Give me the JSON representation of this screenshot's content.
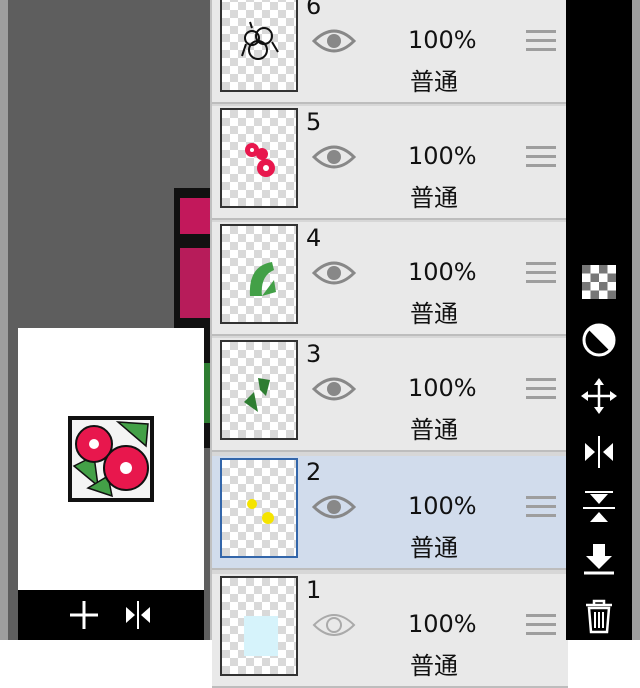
{
  "layers": [
    {
      "number": "6",
      "opacity": "100%",
      "blend": "普通",
      "visible": true
    },
    {
      "number": "5",
      "opacity": "100%",
      "blend": "普通",
      "visible": true
    },
    {
      "number": "4",
      "opacity": "100%",
      "blend": "普通",
      "visible": true
    },
    {
      "number": "3",
      "opacity": "100%",
      "blend": "普通",
      "visible": true
    },
    {
      "number": "2",
      "opacity": "100%",
      "blend": "普通",
      "visible": true,
      "selected": true
    },
    {
      "number": "1",
      "opacity": "100%",
      "blend": "普通",
      "visible": false
    }
  ],
  "toolbar_icons": [
    "checkerboard-icon",
    "opacity-circle-icon",
    "move-arrows-icon",
    "flip-horizontal-icon",
    "flip-vertical-icon",
    "merge-down-icon",
    "trash-icon"
  ],
  "bottom_bar_icons": [
    "add-layer-icon",
    "flip-horizontal-icon"
  ],
  "colors": {
    "selected_layer": "#d1dcec",
    "accent": "#3366aa",
    "flower_red": "#e8174d",
    "leaf_green": "#43a047"
  }
}
